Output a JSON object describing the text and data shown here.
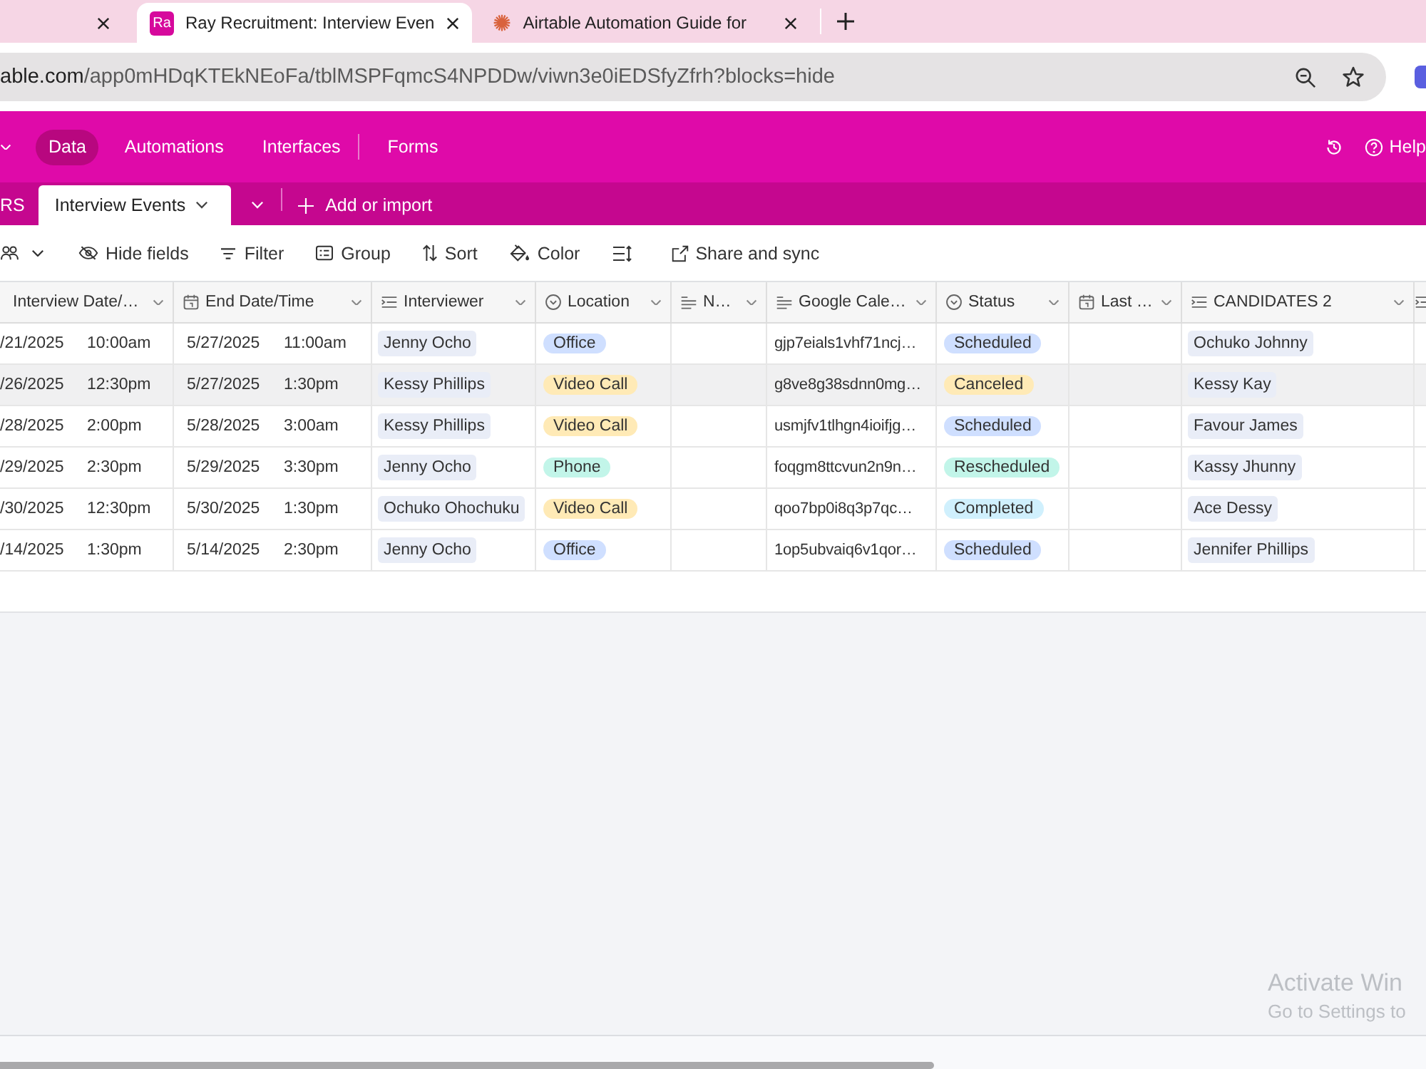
{
  "browser": {
    "tabs": [
      {
        "selected": false
      },
      {
        "selected": true,
        "favicon_text": "Ra",
        "title": "Ray Recruitment: Interview Even"
      },
      {
        "selected": false,
        "title": "Airtable Automation Guide for"
      }
    ],
    "address": {
      "host": "able.com",
      "path": "/app0mHDqKTEkNEoFa/tblMSPFqmcS4NPDDw/viwn3e0iEDSfyZfrh?blocks=hide"
    }
  },
  "app_nav": {
    "items": [
      {
        "label": "Data",
        "selected": true
      },
      {
        "label": "Automations",
        "selected": false
      },
      {
        "label": "Interfaces",
        "selected": false
      },
      {
        "label": "Forms",
        "selected": false
      }
    ],
    "help": "Help"
  },
  "table_tabs": {
    "tabs": [
      {
        "label": "RS",
        "selected": false
      },
      {
        "label": "Interview Events",
        "selected": true
      }
    ],
    "add": "Add or import"
  },
  "toolbar": [
    {
      "kind": "views"
    },
    {
      "kind": "hide",
      "label": "Hide fields"
    },
    {
      "kind": "filter",
      "label": "Filter"
    },
    {
      "kind": "group",
      "label": "Group"
    },
    {
      "kind": "sort",
      "label": "Sort"
    },
    {
      "kind": "color",
      "label": "Color"
    },
    {
      "kind": "row_height"
    },
    {
      "kind": "share",
      "label": "Share and sync"
    }
  ],
  "table": {
    "columns": [
      {
        "label": "Interview Date/…"
      },
      {
        "label": "End Date/Time",
        "kind": "date"
      },
      {
        "label": "Interviewer",
        "kind": "link"
      },
      {
        "label": "Location",
        "kind": "select"
      },
      {
        "label": "N…",
        "kind": "text"
      },
      {
        "label": "Google Cale…",
        "kind": "text"
      },
      {
        "label": "Status",
        "kind": "select"
      },
      {
        "label": "Last …",
        "kind": "date"
      },
      {
        "label": "CANDIDATES 2",
        "kind": "link"
      },
      {
        "kind": "link"
      }
    ],
    "rows": [
      {
        "hovered": false,
        "interview_date": {
          "date": "/21/2025",
          "time": "10:00am"
        },
        "end_date": {
          "date": "5/27/2025",
          "time": "11:00am"
        },
        "interviewer": "Jenny Ocho",
        "location": {
          "label": "Office",
          "color": "#cfdfff"
        },
        "calendar_id": "gjp7eials1vhf71ncj…",
        "status": {
          "label": "Scheduled",
          "color": "#cfdfff"
        },
        "candidate": "Ochuko Johnny"
      },
      {
        "hovered": true,
        "interview_date": {
          "date": "/26/2025",
          "time": "12:30pm"
        },
        "end_date": {
          "date": "5/27/2025",
          "time": "1:30pm"
        },
        "interviewer": "Kessy Phillips",
        "location": {
          "label": "Video Call",
          "color": "#ffeab6"
        },
        "calendar_id": "g8ve8g38sdnn0mg…",
        "status": {
          "label": "Canceled",
          "color": "#ffeab6"
        },
        "candidate": "Kessy Kay"
      },
      {
        "hovered": false,
        "interview_date": {
          "date": "/28/2025",
          "time": "2:00pm"
        },
        "end_date": {
          "date": "5/28/2025",
          "time": "3:00am"
        },
        "interviewer": "Kessy Phillips",
        "location": {
          "label": "Video Call",
          "color": "#ffeab6"
        },
        "calendar_id": "usmjfv1tlhgn4ioifjg…",
        "status": {
          "label": "Scheduled",
          "color": "#cfdfff"
        },
        "candidate": "Favour James"
      },
      {
        "hovered": false,
        "interview_date": {
          "date": "/29/2025",
          "time": "2:30pm"
        },
        "end_date": {
          "date": "5/29/2025",
          "time": "3:30pm"
        },
        "interviewer": "Jenny Ocho",
        "location": {
          "label": "Phone",
          "color": "#c2f5e9"
        },
        "calendar_id": "foqgm8ttcvun2n9n…",
        "status": {
          "label": "Rescheduled",
          "color": "#c2f5e9"
        },
        "candidate": "Kassy Jhunny"
      },
      {
        "hovered": false,
        "interview_date": {
          "date": "/30/2025",
          "time": "12:30pm"
        },
        "end_date": {
          "date": "5/30/2025",
          "time": "1:30pm"
        },
        "interviewer": "Ochuko Ohochuku",
        "location": {
          "label": "Video Call",
          "color": "#ffeab6"
        },
        "calendar_id": "qoo7bp0i8q3p7qc…",
        "status": {
          "label": "Completed",
          "color": "#d0f0fd"
        },
        "candidate": "Ace Dessy"
      },
      {
        "hovered": false,
        "interview_date": {
          "date": "/14/2025",
          "time": "1:30pm"
        },
        "end_date": {
          "date": "5/14/2025",
          "time": "2:30pm"
        },
        "interviewer": "Jenny Ocho",
        "location": {
          "label": "Office",
          "color": "#cfdfff"
        },
        "calendar_id": "1op5ubvaiq6v1qor…",
        "status": {
          "label": "Scheduled",
          "color": "#cfdfff"
        },
        "candidate": "Jennifer Phillips"
      }
    ]
  },
  "watermark": {
    "title": "Activate Win",
    "subtitle": "Go to Settings to"
  }
}
